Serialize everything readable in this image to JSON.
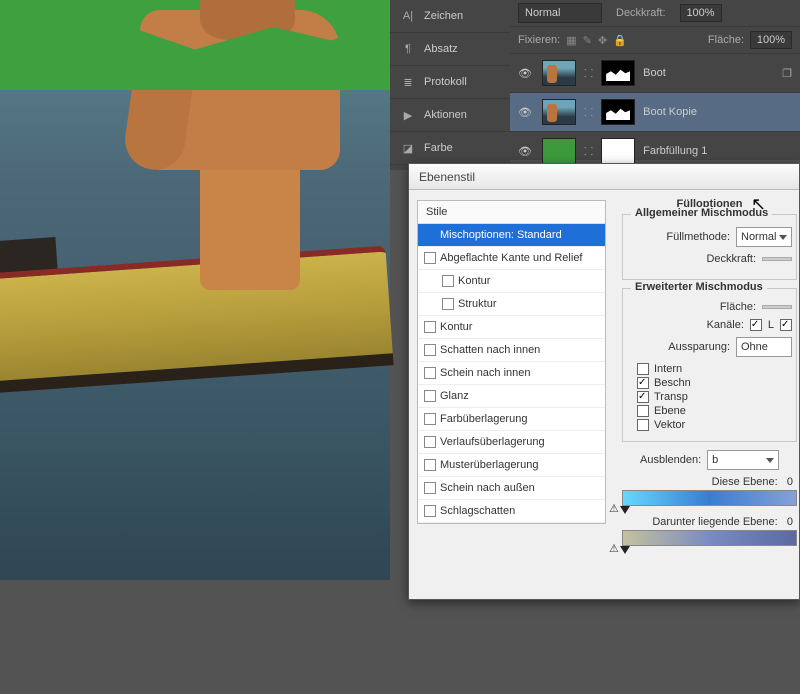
{
  "side_items": [
    {
      "icon": "A|",
      "label": "Zeichen"
    },
    {
      "icon": "¶",
      "label": "Absatz"
    },
    {
      "icon": "≣",
      "label": "Protokoll"
    },
    {
      "icon": "▶",
      "label": "Aktionen"
    },
    {
      "icon": "◪",
      "label": "Farbe"
    }
  ],
  "layers": {
    "blend_mode": "Normal",
    "opacity_label": "Deckkraft:",
    "opacity_value": "100%",
    "lock_label": "Fixieren:",
    "fill_label": "Fläche:",
    "fill_value": "100%",
    "rows": [
      {
        "name": "Boot",
        "selected": false,
        "thumb": "photo"
      },
      {
        "name": "Boot Kopie",
        "selected": true,
        "thumb": "photo"
      },
      {
        "name": "Farbfüllung 1",
        "selected": false,
        "thumb": "fill"
      }
    ]
  },
  "dialog": {
    "title": "Ebenenstil",
    "stile_header": "Stile",
    "stile_items": [
      {
        "label": "Mischoptionen: Standard",
        "selected": true,
        "checkbox": false,
        "indent": 0
      },
      {
        "label": "Abgeflachte Kante und Relief",
        "checkbox": true,
        "indent": 0
      },
      {
        "label": "Kontur",
        "checkbox": true,
        "indent": 1
      },
      {
        "label": "Struktur",
        "checkbox": true,
        "indent": 1
      },
      {
        "label": "Kontur",
        "checkbox": true,
        "indent": 0
      },
      {
        "label": "Schatten nach innen",
        "checkbox": true,
        "indent": 0
      },
      {
        "label": "Schein nach innen",
        "checkbox": true,
        "indent": 0
      },
      {
        "label": "Glanz",
        "checkbox": true,
        "indent": 0
      },
      {
        "label": "Farbüberlagerung",
        "checkbox": true,
        "indent": 0
      },
      {
        "label": "Verlaufsüberlagerung",
        "checkbox": true,
        "indent": 0
      },
      {
        "label": "Musterüberlagerung",
        "checkbox": true,
        "indent": 0
      },
      {
        "label": "Schein nach außen",
        "checkbox": true,
        "indent": 0
      },
      {
        "label": "Schlagschatten",
        "checkbox": true,
        "indent": 0
      }
    ],
    "fill_options_title": "Fülloptionen",
    "general_title": "Allgemeiner Mischmodus",
    "fullmethode_label": "Füllmethode:",
    "fullmethode_value": "Normal",
    "deckkraft_label": "Deckkraft:",
    "adv_title": "Erweiterter Mischmodus",
    "flache_label": "Fläche:",
    "kanale_label": "Kanäle:",
    "kanal_L": "L",
    "aussparung_label": "Aussparung:",
    "aussparung_value": "Ohne",
    "adv_checks": [
      {
        "label": "Intern",
        "checked": false
      },
      {
        "label": "Beschn",
        "checked": true
      },
      {
        "label": "Transp",
        "checked": true
      },
      {
        "label": "Ebene",
        "checked": false
      },
      {
        "label": "Vektor",
        "checked": false
      }
    ],
    "ausblenden_label": "Ausblenden:",
    "ausblenden_value": "b",
    "this_layer_label": "Diese Ebene:",
    "this_layer_val": "0",
    "under_layer_label": "Darunter liegende Ebene:",
    "under_layer_val": "0"
  }
}
